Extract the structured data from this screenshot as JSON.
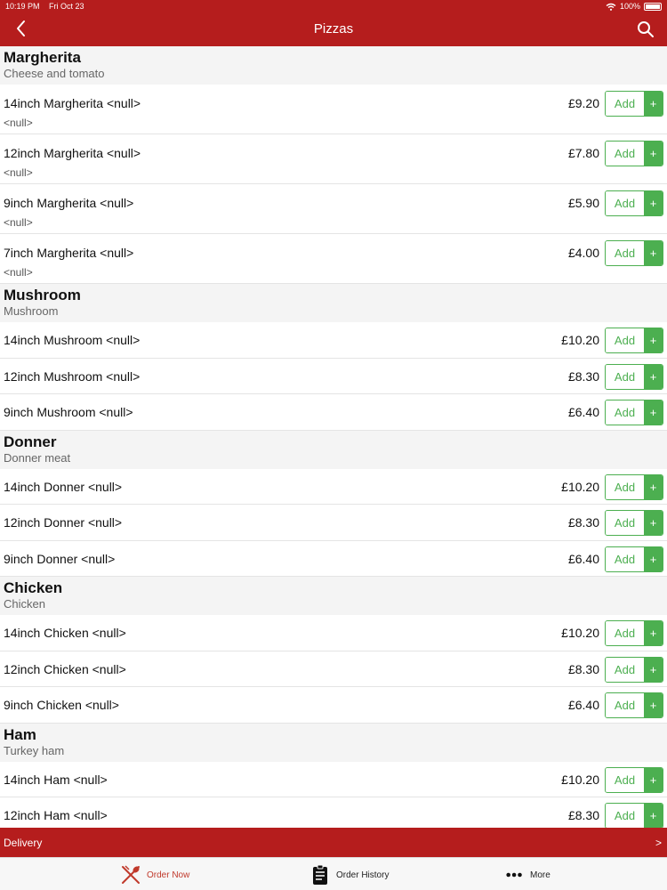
{
  "status_bar": {
    "time": "10:19 PM",
    "date": "Fri Oct 23",
    "battery": "100%"
  },
  "header": {
    "title": "Pizzas",
    "back_icon": "chevron-left-icon",
    "search_icon": "search-icon"
  },
  "groups": [
    {
      "title": "Margherita",
      "description": "Cheese and tomato",
      "items": [
        {
          "name": "14inch Margherita <null>",
          "note": "<null>",
          "price": "£9.20"
        },
        {
          "name": "12inch Margherita <null>",
          "note": "<null>",
          "price": "£7.80"
        },
        {
          "name": "9inch Margherita <null>",
          "note": "<null>",
          "price": "£5.90"
        },
        {
          "name": "7inch Margherita <null>",
          "note": "<null>",
          "price": "£4.00"
        }
      ]
    },
    {
      "title": "Mushroom",
      "description": "Mushroom",
      "items": [
        {
          "name": "14inch Mushroom <null>",
          "price": "£10.20"
        },
        {
          "name": "12inch Mushroom <null>",
          "price": "£8.30"
        },
        {
          "name": "9inch Mushroom <null>",
          "price": "£6.40"
        }
      ]
    },
    {
      "title": "Donner",
      "description": "Donner meat",
      "items": [
        {
          "name": "14inch Donner <null>",
          "price": "£10.20"
        },
        {
          "name": "12inch Donner <null>",
          "price": "£8.30"
        },
        {
          "name": "9inch Donner <null>",
          "price": "£6.40"
        }
      ]
    },
    {
      "title": "Chicken",
      "description": "Chicken",
      "items": [
        {
          "name": "14inch Chicken <null>",
          "price": "£10.20"
        },
        {
          "name": "12inch Chicken <null>",
          "price": "£8.30"
        },
        {
          "name": "9inch Chicken <null>",
          "price": "£6.40"
        }
      ]
    },
    {
      "title": "Ham",
      "description": "Turkey ham",
      "items": [
        {
          "name": "14inch Ham <null>",
          "price": "£10.20"
        },
        {
          "name": "12inch Ham <null>",
          "price": "£8.30"
        }
      ]
    }
  ],
  "add_button": {
    "label": "Add",
    "plus": "+"
  },
  "delivery_bar": {
    "label": "Delivery",
    "arrow": ">"
  },
  "tabs": [
    {
      "label": "Order Now",
      "icon": "fork-knife-icon",
      "active": true
    },
    {
      "label": "Order History",
      "icon": "clipboard-icon",
      "active": false
    },
    {
      "label": "More",
      "icon": "more-dots-icon",
      "active": false
    }
  ],
  "colors": {
    "brand_red": "#b51d1d",
    "add_green": "#4caf50",
    "active_tab": "#c0392b"
  }
}
